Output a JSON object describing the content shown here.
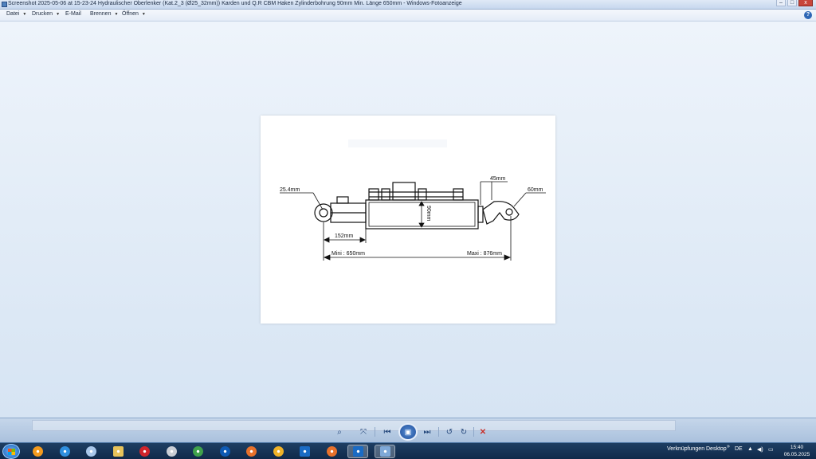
{
  "window": {
    "title": "Screenshot 2025-05-06 at 15-23-24 Hydraulischer Oberlenker (Kat.2_3 (Ø25_32mm)) Karden und Q.R CBM Haken Zylinderbohrung 90mm Min. Länge 650mm - Windows-Fotoanzeige",
    "buttons": {
      "minimize": "–",
      "maximize": "□",
      "close": "x"
    }
  },
  "menu": {
    "items": [
      {
        "label": "Datei",
        "caret": "▼"
      },
      {
        "label": "Drucken",
        "caret": "▼"
      },
      {
        "label": "E-Mail",
        "caret": ""
      },
      {
        "label": "Brennen",
        "caret": "▼"
      },
      {
        "label": "Öffnen",
        "caret": "▼"
      }
    ],
    "help": "?"
  },
  "drawing": {
    "pin_diameter": "25.4mm",
    "hook_width": "45mm",
    "hook_opening": "60mm",
    "bore": "90mm",
    "pin_to_cylinder": "152mm",
    "length_min": "Mini : 650mm",
    "length_max": "Maxi : 876mm"
  },
  "controls": {
    "zoom": "⌕",
    "actual_size": "⤧",
    "previous": "⏮",
    "slideshow": "▣",
    "next": "⏭",
    "rotate_left": "↺",
    "rotate_right": "↻",
    "delete": "✕"
  },
  "taskbar": {
    "apps": [
      {
        "name": "media-player-icon",
        "color": "#f39a1e"
      },
      {
        "name": "internet-explorer-icon",
        "color": "#2f8fdf"
      },
      {
        "name": "app-diamond-icon",
        "color": "#a9c7ea"
      },
      {
        "name": "file-explorer-icon",
        "color": "#e8c35a"
      },
      {
        "name": "opera-icon",
        "color": "#d0242b"
      },
      {
        "name": "app-gear-icon",
        "color": "#c9ced6"
      },
      {
        "name": "chrome-icon",
        "color": "#3fa14b"
      },
      {
        "name": "teamviewer-icon",
        "color": "#0e5ab4"
      },
      {
        "name": "firefox-icon",
        "color": "#e8712b"
      },
      {
        "name": "app-shield-icon",
        "color": "#f0b227"
      },
      {
        "name": "outlook-icon",
        "color": "#1a6bc4"
      },
      {
        "name": "firefox-icon",
        "color": "#e8712b"
      },
      {
        "name": "outlook-icon",
        "color": "#1a6bc4"
      },
      {
        "name": "photo-viewer-icon",
        "color": "#7fa9d8"
      }
    ],
    "toolbar_links": "Verknüpfungen",
    "toolbar_desktop": "Desktop",
    "chevron": "»",
    "language": "DE",
    "time": "15:40",
    "date": "06.05.2025"
  },
  "colors": {
    "accent": "#1d4e9a",
    "background": "#d6e4f3",
    "taskbar": "#10294a"
  }
}
